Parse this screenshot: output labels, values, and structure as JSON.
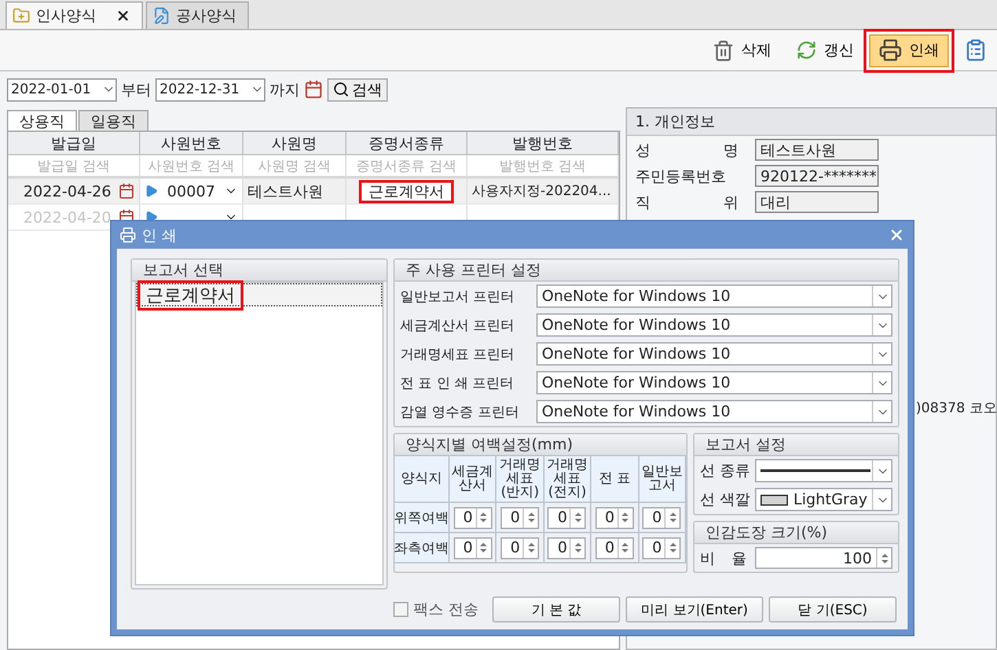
{
  "doc_tabs": [
    {
      "label": "인사양식",
      "selected": true,
      "closable": true
    },
    {
      "label": "공사양식",
      "selected": false,
      "closable": false
    }
  ],
  "toolbar": [
    {
      "label": "삭제",
      "kind": "trash",
      "highlighted": false
    },
    {
      "label": "갱신",
      "kind": "refresh",
      "highlighted": false
    },
    {
      "label": "인쇄",
      "kind": "print",
      "highlighted": true
    },
    {
      "kind": "clipboard",
      "highlighted": false
    }
  ],
  "filter": {
    "from": "2022-01-01",
    "from_suffix": "부터",
    "to": "2022-12-31",
    "to_suffix": "까지",
    "search": "검색"
  },
  "sub_tabs": [
    {
      "label": "상용직",
      "selected": true
    },
    {
      "label": "일용직",
      "selected": false
    }
  ],
  "grid": {
    "columns": [
      "발급일",
      "사원번호",
      "사원명",
      "증명서종류",
      "발행번호"
    ],
    "filters": [
      "발급일 검색",
      "사원번호 검색",
      "사원명 검색",
      "증명서종류 검색",
      "발행번호 검색"
    ],
    "rows": [
      {
        "date": "2022-04-26",
        "employee_no": "00007",
        "name": "테스트사원",
        "certificate": "근로계약서",
        "certificate_highlighted": true,
        "issue_no": "사용자지정-202204...",
        "disabled": false
      },
      {
        "date": "2022-04-20",
        "disabled": true
      }
    ]
  },
  "personal": {
    "title": "1. 개인정보",
    "fields": [
      {
        "label": "성 명",
        "value": "테스트사원"
      },
      {
        "label": "주민등록번호",
        "value": "920122-*******"
      },
      {
        "label": "직 위",
        "value": "대리"
      }
    ],
    "address_fragment": ")08378 코오"
  },
  "dialog": {
    "title": "인 쇄",
    "report_group": {
      "title": "보고서 선택",
      "items": [
        {
          "label": "근로계약서",
          "selected": true,
          "highlighted": true
        }
      ]
    },
    "printer_group": {
      "title": "주 사용 프린터 설정",
      "rows": [
        {
          "label": "일반보고서 프린터",
          "value": "OneNote for Windows 10"
        },
        {
          "label": "세금계산서 프린터",
          "value": "OneNote for Windows 10"
        },
        {
          "label": "거래명세표 프린터",
          "value": "OneNote for Windows 10"
        },
        {
          "label": "전 표 인 쇄 프린터",
          "value": "OneNote for Windows 10"
        },
        {
          "label": "감열 영수증 프린터",
          "value": "OneNote for Windows 10"
        }
      ]
    },
    "margin_group": {
      "title": "양식지별 여백설정(mm)",
      "columns": [
        "양식지",
        "세금계산서",
        "거래명세표(반지)",
        "거래명세표(전지)",
        "전 표",
        "일반보고서"
      ],
      "rows": [
        {
          "label": "위쪽여백",
          "values": [
            "0",
            "0",
            "0",
            "0",
            "0"
          ]
        },
        {
          "label": "좌측여백",
          "values": [
            "0",
            "0",
            "0",
            "0",
            "0"
          ]
        }
      ]
    },
    "report_settings": {
      "title": "보고서 설정",
      "line_type_label": "선 종류",
      "line_color_label": "선 색깔",
      "line_color": "LightGray"
    },
    "seal": {
      "title": "인감도장 크기(%)",
      "label": "비 율",
      "value": "100"
    },
    "fax": {
      "label": "팩스 전송",
      "checked": false
    },
    "buttons": [
      "기 본 값",
      "미리 보기(Enter)",
      "닫 기(ESC)"
    ]
  }
}
